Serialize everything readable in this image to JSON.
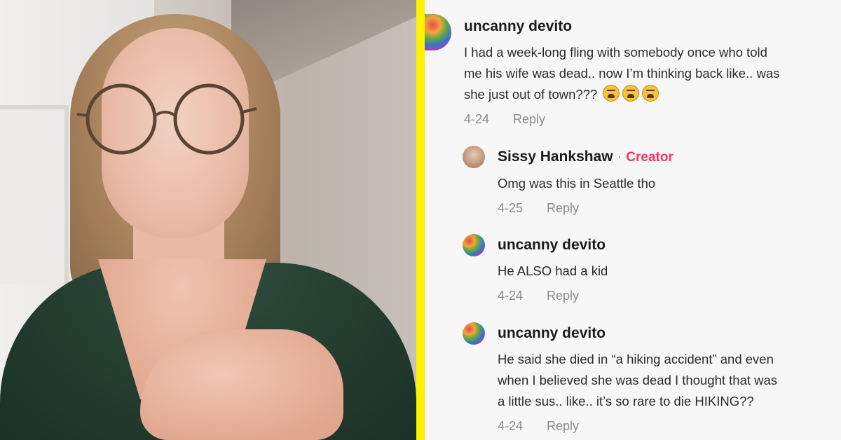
{
  "comments": [
    {
      "username": "uncanny devito",
      "lines": [
        "I had a week-long fling with somebody once who told",
        "me his wife was dead.. now I’m thinking back like.. was",
        "she just out of town???"
      ],
      "emoji_count": 3,
      "date": "4-24",
      "reply": "Reply"
    },
    {
      "username": "Sissy Hankshaw",
      "separator": "·",
      "tag": "Creator",
      "lines": [
        "Omg was this in Seattle tho"
      ],
      "date": "4-25",
      "reply": "Reply"
    },
    {
      "username": "uncanny devito",
      "lines": [
        "He ALSO had a kid"
      ],
      "date": "4-24",
      "reply": "Reply"
    },
    {
      "username": "uncanny devito",
      "lines": [
        "He said she died in “a hiking accident” and even",
        "when I believed she was dead I thought that was",
        "a little sus.. like.. it’s so rare to die HIKING??"
      ],
      "date": "4-24",
      "reply": "Reply"
    }
  ],
  "colors": {
    "divider": "#fff200",
    "creator": "#f0385e",
    "meta": "#8a8a8a"
  },
  "icons": {
    "emoji": "weary-face-emoji"
  }
}
